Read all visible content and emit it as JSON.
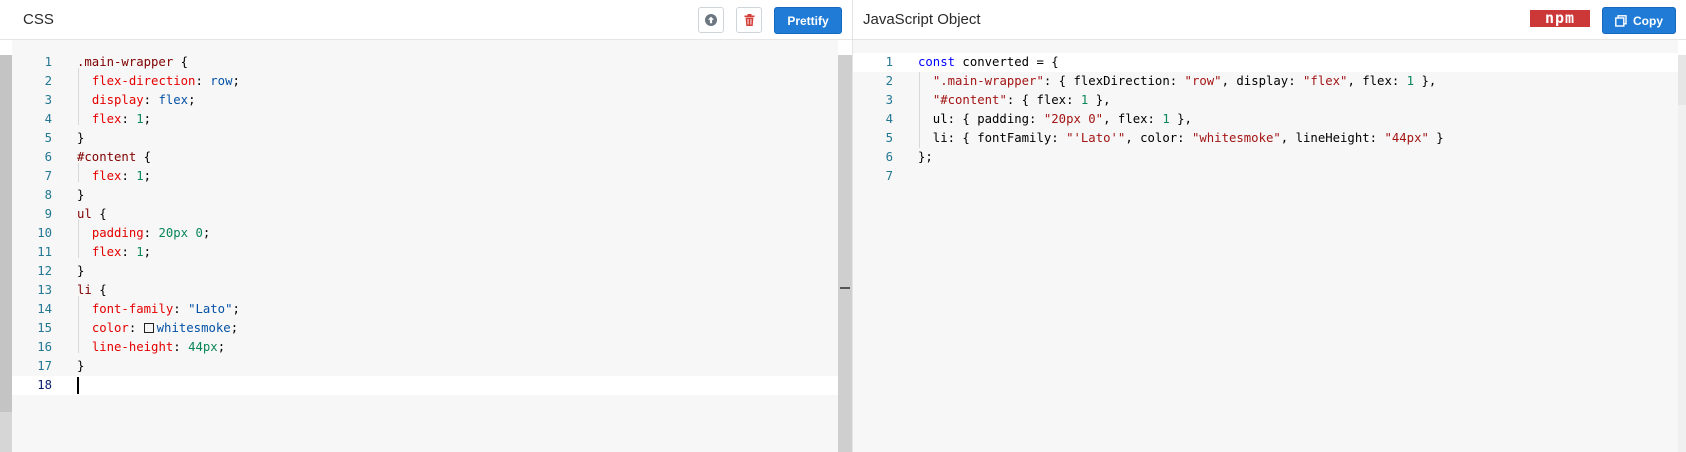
{
  "css_panel": {
    "title": "CSS",
    "upload_icon": "upload-icon",
    "delete_icon": "trash-icon",
    "prettify_label": "Prettify",
    "line_numbers": [
      "1",
      "2",
      "3",
      "4",
      "5",
      "6",
      "7",
      "8",
      "9",
      "10",
      "11",
      "12",
      "13",
      "14",
      "15",
      "16",
      "17",
      "18"
    ],
    "lines": [
      ".main-wrapper {",
      "  flex-direction: row;",
      "  display: flex;",
      "  flex: 1;",
      "}",
      "#content {",
      "  flex: 1;",
      "}",
      "ul {",
      "  padding: 20px 0;",
      "  flex: 1;",
      "}",
      "li {",
      "  font-family: \"Lato\";",
      "  color: whitesmoke;",
      "  line-height: 44px;",
      "}",
      ""
    ]
  },
  "js_panel": {
    "title": "JavaScript Object",
    "npm_logo_text": "npm",
    "copy_label": "Copy",
    "copy_icon": "copy-icon",
    "line_numbers": [
      "1",
      "2",
      "3",
      "4",
      "5",
      "6",
      "7"
    ],
    "lines": [
      "const converted = {",
      "  \".main-wrapper\": { flexDirection: \"row\", display: \"flex\", flex: 1 },",
      "  \"#content\": { flex: 1 },",
      "  ul: { padding: \"20px 0\", flex: 1 },",
      "  li: { fontFamily: \"'Lato'\", color: \"whitesmoke\", lineHeight: \"44px\" }",
      "};",
      ""
    ]
  },
  "colors": {
    "primary_button": "#1f7bd6",
    "npm_red": "#cb3837",
    "delete_red": "#d43f3a",
    "editor_bg": "#f7f7f7"
  }
}
